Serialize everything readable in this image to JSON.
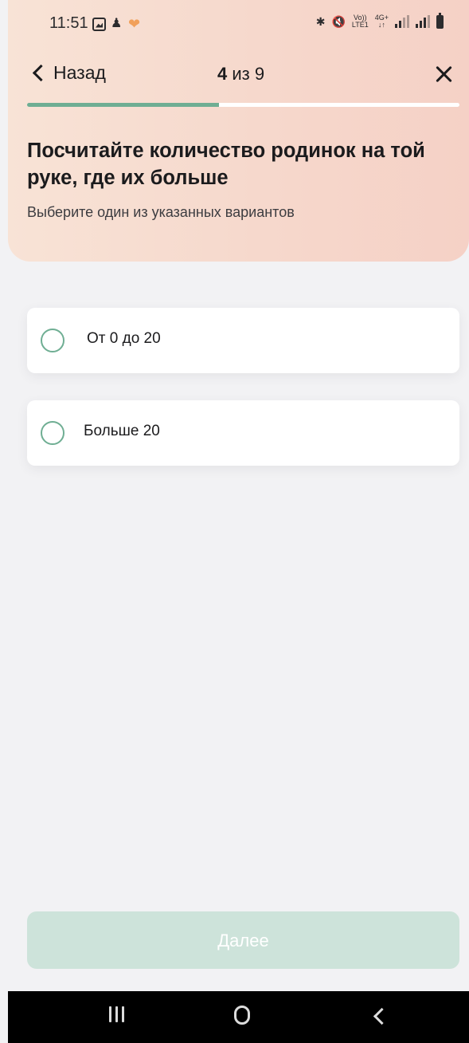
{
  "status_bar": {
    "time": "11:51",
    "left_icons": [
      "gallery-icon",
      "app-notification-icon",
      "heart-icon"
    ],
    "right_icons": [
      "bluetooth-icon",
      "mute-icon",
      "volte-icon",
      "network-4g-icon",
      "signal-icon",
      "signal-icon",
      "battery-icon"
    ],
    "volte_label_top": "Vo))",
    "volte_label_bottom": "LTE1",
    "network_label_top": "4G+",
    "network_label_bottom": "↓↑"
  },
  "nav": {
    "back_label": "Назад",
    "progress_current": "4",
    "progress_rest": " из 9"
  },
  "progress": {
    "current": 4,
    "total": 9
  },
  "question": {
    "title": "Посчитайте количество родинок на той руке, где их больше",
    "subtitle": "Выберите один из указанных вариантов"
  },
  "options": [
    {
      "label": "От 0 до 20",
      "selected": false
    },
    {
      "label": "Больше 20",
      "selected": false
    }
  ],
  "footer": {
    "next_label": "Далее",
    "enabled": false
  },
  "colors": {
    "accent": "#6fae93",
    "header_bg": "#f8e3d6",
    "button_disabled": "#cde3da"
  }
}
